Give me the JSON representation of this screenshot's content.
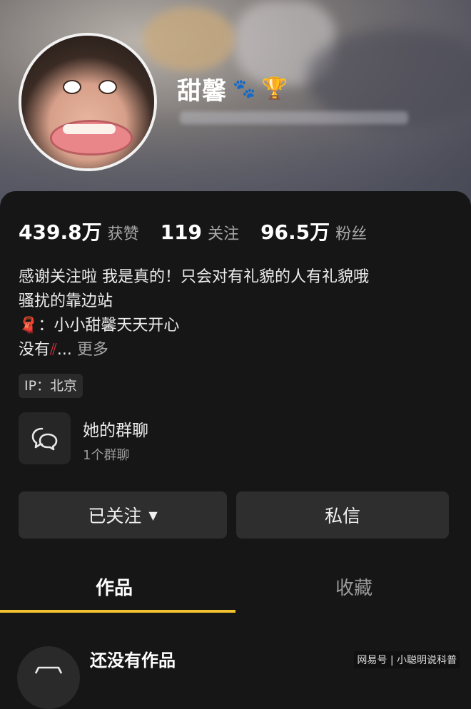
{
  "profile": {
    "name": "甜馨",
    "badges": [
      "🐾",
      "🏆"
    ]
  },
  "stats": [
    {
      "num": "439.8万",
      "label": "获赞"
    },
    {
      "num": "119",
      "label": "关注"
    },
    {
      "num": "96.5万",
      "label": "粉丝"
    }
  ],
  "bio": {
    "line1": "感谢关注啦 我是真的！只会对有礼貌的人有礼貌哦",
    "line2": "骚扰的靠边站",
    "line3_icon": "🧣",
    "line3_text": "：小小甜馨天天开心",
    "line4_text": "没有",
    "line4_icon": "⫽",
    "line4_ellipsis": "...",
    "more": "更多"
  },
  "ip": "IP：北京",
  "group": {
    "title": "她的群聊",
    "subtitle": "1个群聊"
  },
  "buttons": {
    "follow": "已关注",
    "message": "私信"
  },
  "tabs": {
    "works": "作品",
    "favorites": "收藏"
  },
  "empty": {
    "title": "还没有作品"
  },
  "watermark": "网易号 | 小聪明说科普",
  "colors": {
    "accent": "#f2c230",
    "background": "#161616",
    "button": "#2e2e2e"
  }
}
